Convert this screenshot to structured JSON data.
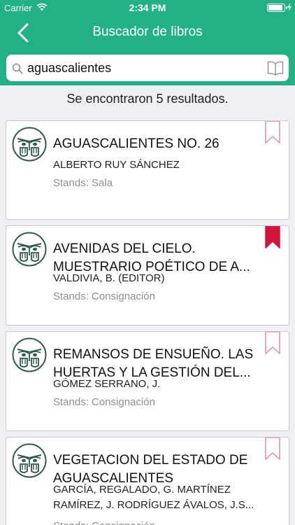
{
  "status_bar": {
    "carrier": "Carrier",
    "time": "2:34 PM"
  },
  "nav": {
    "title": "Buscador de libros",
    "back_icon": "chevron-left-icon"
  },
  "search": {
    "value": "aguascalientes",
    "search_icon": "search-icon",
    "book_icon": "open-book-icon"
  },
  "results_text": "Se encontraron 5 resultados.",
  "colors": {
    "header": "#21b184",
    "bookmark_active": "#d2153d",
    "bookmark_inactive": "#e68ca1"
  },
  "books": [
    {
      "title": "AGUASCALIENTES NO. 26",
      "author": "ALBERTO RUY SÁNCHEZ",
      "stands": "Stands: Sala",
      "bookmarked": false
    },
    {
      "title": "AVENIDAS DEL CIELO. MUESTRARIO POÉTICO DE A...",
      "author": "VALDIVIA, B. (EDITOR)",
      "stands": "Stands: Consignación",
      "bookmarked": true
    },
    {
      "title": "REMANSOS DE ENSUEÑO. LAS HUERTAS Y LA GESTIÓN DEL...",
      "author": "GÓMEZ SERRANO, J.",
      "stands": "Stands: Consignación",
      "bookmarked": false
    },
    {
      "title": "VEGETACION DEL ESTADO DE AGUASCALIENTES",
      "author": "GARCÍA, REGALADO, G. MARTÍNEZ RAMÍREZ, J. RODRÍGUEZ ÁVALOS, J.S...",
      "stands": "Stands: Consignación",
      "bookmarked": false
    }
  ]
}
